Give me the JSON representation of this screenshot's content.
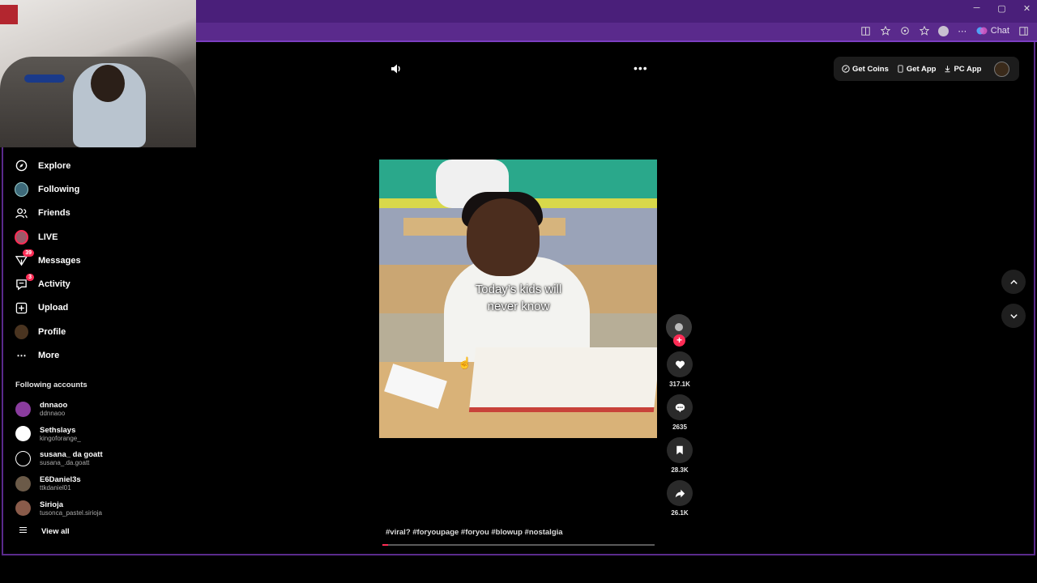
{
  "browser": {
    "window_controls": [
      "─",
      "▢",
      "✕"
    ],
    "chat_label": "Chat"
  },
  "topbar": {
    "get_coins": "Get Coins",
    "get_app": "Get App",
    "pc_app": "PC App"
  },
  "sidebar": {
    "items": [
      {
        "label": "Explore",
        "icon": "compass-icon"
      },
      {
        "label": "Following",
        "icon": "following-icon"
      },
      {
        "label": "Friends",
        "icon": "friends-icon"
      },
      {
        "label": "LIVE",
        "icon": "live-icon"
      },
      {
        "label": "Messages",
        "icon": "messages-icon",
        "badge": "39"
      },
      {
        "label": "Activity",
        "icon": "activity-icon",
        "badge": "3"
      },
      {
        "label": "Upload",
        "icon": "upload-icon"
      },
      {
        "label": "Profile",
        "icon": "profile-icon"
      },
      {
        "label": "More",
        "icon": "more-icon"
      }
    ],
    "following_header": "Following accounts",
    "accounts": [
      {
        "name": "dnnaoo",
        "handle": "ddnnaoo",
        "color": "#8a3c9e"
      },
      {
        "name": "Sethslays",
        "handle": "kingoforange_",
        "color": "#ffffff"
      },
      {
        "name": "susana_ da goatt",
        "handle": "susana_.da.goatt",
        "color": "#000000"
      },
      {
        "name": "E6Daniel3s",
        "handle": "ttkdaniel01",
        "color": "#6b5a48"
      },
      {
        "name": "Sirioja",
        "handle": "tusonca_pastel.sirioja",
        "color": "#8a5b4a"
      }
    ],
    "view_all": "View all"
  },
  "video": {
    "caption_line1": "Today’s kids will",
    "caption_line2": "never know",
    "hashtags": "#viral? #foryoupage #foryou #blowup #nostalgia",
    "progress_fraction": 0.02
  },
  "actions": {
    "likes": "317.1K",
    "comments": "2635",
    "saves": "28.3K",
    "shares": "26.1K"
  },
  "colors": {
    "accent": "#fe2c55",
    "browser_frame": "#5a2a8c"
  }
}
